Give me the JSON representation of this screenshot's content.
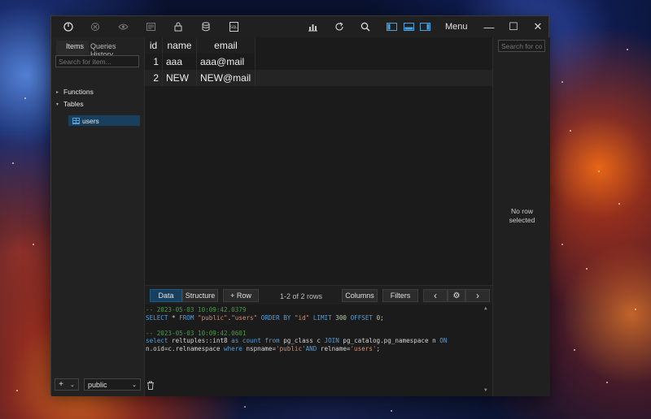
{
  "toolbar": {
    "menu_label": "Menu",
    "icons": [
      "disconnect-icon",
      "cancel-icon",
      "preview-icon",
      "filter-icon",
      "lock-icon",
      "database-icon",
      "sql-icon",
      "chart-icon",
      "refresh-icon",
      "search-icon",
      "layout-left-icon",
      "layout-bottom-icon",
      "layout-right-icon"
    ]
  },
  "window_controls": {
    "minimize": "—",
    "maximize": "☐",
    "close": "✕"
  },
  "sidebar": {
    "tabs": [
      {
        "label": "Items"
      },
      {
        "label": "Queries History"
      }
    ],
    "search_placeholder": "Search for item...",
    "tree": [
      {
        "label": "Functions"
      },
      {
        "label": "Tables"
      },
      {
        "label": "users",
        "selected": true
      }
    ],
    "add_button": "+",
    "schema": "public"
  },
  "grid": {
    "columns": [
      "id",
      "name",
      "email"
    ],
    "rows": [
      {
        "id": "1",
        "name": "aaa",
        "email": "aaa@mail"
      },
      {
        "id": "2",
        "name": "NEW",
        "email": "NEW@mail"
      }
    ]
  },
  "bottom_toolbar": {
    "tab_data": "Data",
    "tab_structure": "Structure",
    "add_row": "+ Row",
    "rows_label": "1-2 of 2 rows",
    "columns_button": "Columns",
    "filters_button": "Filters",
    "prev": "‹",
    "settings": "⚙",
    "next": "›"
  },
  "log": {
    "entry1_comment": "-- 2023-05-03 10:09:42.0379",
    "entry1_sql": "SELECT * FROM \"public\".\"users\" ORDER BY \"id\" LIMIT 300 OFFSET 0;",
    "entry2_comment": "-- 2023-05-03 10:09:42.0601",
    "entry2_sql_line1": "select reltuples::int8 as count from pg_class c JOIN pg_catalog.pg_namespace n ON",
    "entry2_sql_line2": "n.oid=c.relnamespace where nspname='public'AND relname='users';"
  },
  "right_panel": {
    "search_placeholder": "Search for col",
    "empty_line1": "No row",
    "empty_line2": "selected"
  },
  "colors": {
    "accent": "#183f5e",
    "window_bg": "#1e1e1e",
    "sql_keyword": "#569cd6",
    "sql_string": "#ce9178",
    "sql_comment": "#4a9a4a"
  }
}
